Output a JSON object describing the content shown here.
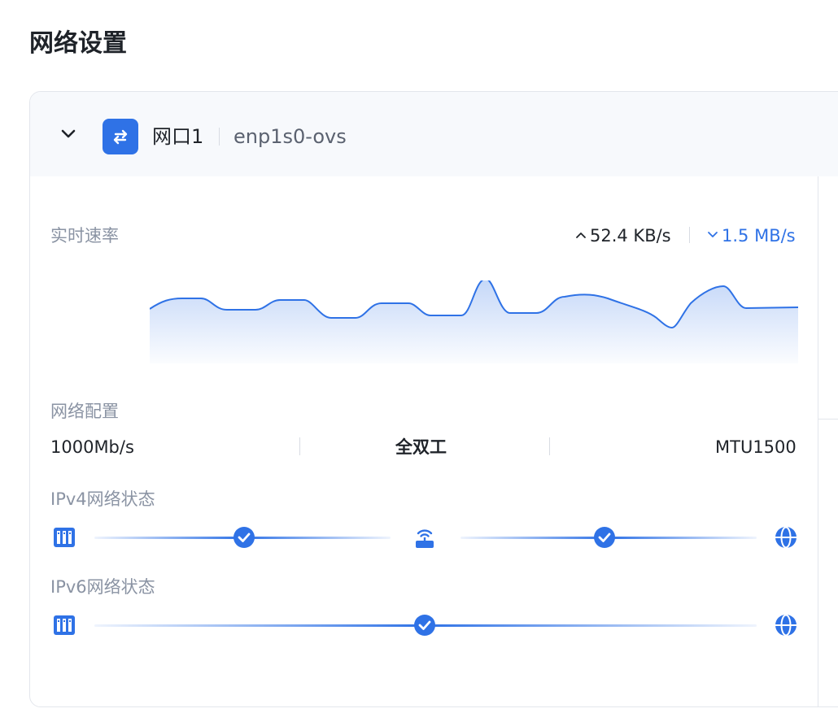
{
  "page": {
    "title": "网络设置"
  },
  "interface": {
    "name": "网口1",
    "device": "enp1s0-ovs"
  },
  "rate": {
    "label": "实时速率",
    "upload": "52.4 KB/s",
    "download": "1.5 MB/s"
  },
  "config": {
    "label": "网络配置",
    "speed": "1000Mb/s",
    "duplex": "全双工",
    "mtu": "MTU1500"
  },
  "ipv4": {
    "label": "IPv4网络状态"
  },
  "ipv6": {
    "label": "IPv6网络状态"
  },
  "icons": {
    "collapse": "chevron-down-icon",
    "interface": "swap-arrows-icon",
    "device": "server-icon",
    "router": "router-icon",
    "internet": "globe-icon",
    "ok": "check-circle-icon"
  },
  "colors": {
    "accent": "#2f72e6",
    "muted_text": "#8a93a3",
    "header_bg": "#f7f9fc"
  }
}
